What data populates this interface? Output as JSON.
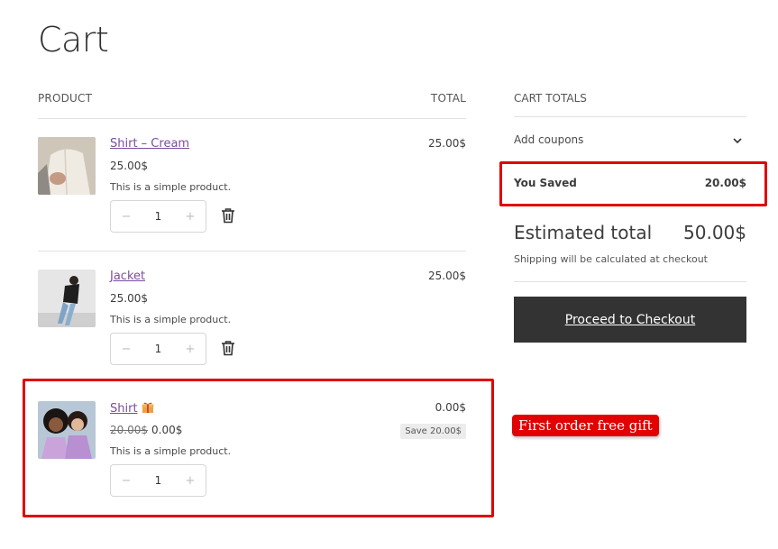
{
  "page": {
    "title": "Cart"
  },
  "cart": {
    "header": {
      "product": "PRODUCT",
      "total": "TOTAL"
    },
    "items": [
      {
        "name": "Shirt – Cream",
        "unit_price": "25.00$",
        "description": "This is a simple product.",
        "quantity": "1",
        "line_total": "25.00$",
        "thumbnail": "shirt-cream-photo"
      },
      {
        "name": "Jacket",
        "unit_price": "25.00$",
        "description": "This is a simple product.",
        "quantity": "1",
        "line_total": "25.00$",
        "thumbnail": "jacket-photo"
      },
      {
        "name": "Shirt",
        "icon": "gift-icon",
        "old_price": "20.00$",
        "unit_price": "0.00$",
        "description": "This is a simple product.",
        "quantity": "1",
        "line_total": "0.00$",
        "save_badge": "Save 20.00$",
        "thumbnail": "shirt-photo"
      }
    ],
    "qty_minus": "−",
    "qty_plus": "+"
  },
  "totals": {
    "title": "CART TOTALS",
    "add_coupons": "Add coupons",
    "you_saved_label": "You Saved",
    "you_saved_value": "20.00$",
    "estimated_total_label": "Estimated total",
    "estimated_total_value": "50.00$",
    "shipping_note": "Shipping will be calculated at checkout",
    "checkout_label": "Proceed to Checkout"
  },
  "annotation": {
    "gift_label": "First order free gift",
    "highlight_color": "#e00000"
  },
  "colors": {
    "link": "#7a4c9e",
    "button_bg": "#333333"
  }
}
